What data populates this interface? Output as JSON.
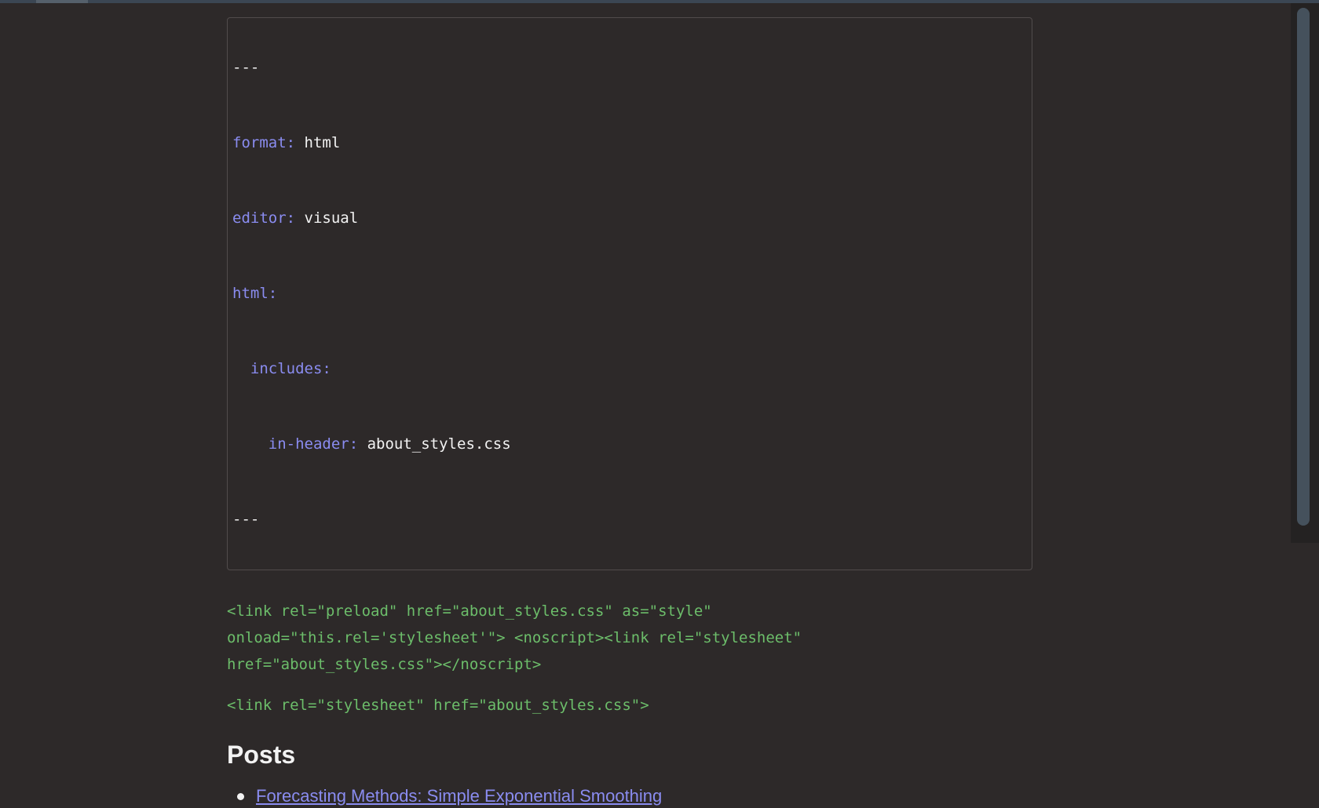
{
  "yaml": {
    "open_fence": "---",
    "lines": [
      {
        "indent": "",
        "key": "format",
        "sep": ": ",
        "value": "html"
      },
      {
        "indent": "",
        "key": "editor",
        "sep": ": ",
        "value": "visual"
      },
      {
        "indent": "",
        "key": "html",
        "sep": ":",
        "value": ""
      },
      {
        "indent": "  ",
        "key": "includes",
        "sep": ":",
        "value": ""
      },
      {
        "indent": "    ",
        "key": "in-header",
        "sep": ": ",
        "value": "about_styles.css"
      }
    ],
    "close_fence": "---"
  },
  "raw_html": {
    "block1": "<link rel=\"preload\" href=\"about_styles.css\" as=\"style\" onload=\"this.rel='stylesheet'\"> <noscript><link rel=\"stylesheet\" href=\"about_styles.css\"></noscript>",
    "block2": "<link rel=\"stylesheet\" href=\"about_styles.css\">"
  },
  "posts": {
    "heading": "Posts",
    "items": [
      {
        "label": "Forecasting Methods: Simple Exponential Smoothing"
      }
    ]
  },
  "colors": {
    "background": "#2d2929",
    "yaml_key": "#8a8cf0",
    "raw_html": "#6cbd6a",
    "link": "#8a8cf0"
  }
}
